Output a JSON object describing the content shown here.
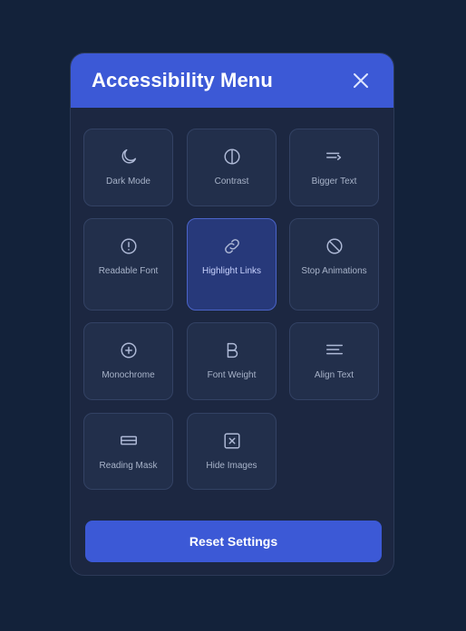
{
  "menu": {
    "title": "Accessibility Menu",
    "reset_label": "Reset Settings",
    "accent": "#3c59d6",
    "items": [
      {
        "label": "Dark Mode",
        "icon": "moon-icon",
        "active": true
      },
      {
        "label": "Contrast",
        "icon": "contrast-icon",
        "active": false
      },
      {
        "label": "Bigger Text",
        "icon": "text-size-icon",
        "active": false
      },
      {
        "label": "Readable Font",
        "icon": "alert-circle-icon",
        "active": false
      },
      {
        "label": "Highlight Links",
        "icon": "link-icon",
        "active": true
      },
      {
        "label": "Stop Animations",
        "icon": "stop-circle-icon",
        "active": false
      },
      {
        "label": "Monochrome",
        "icon": "plus-circle-icon",
        "active": false
      },
      {
        "label": "Font Weight",
        "icon": "bold-icon",
        "active": false
      },
      {
        "label": "Align Text",
        "icon": "align-left-icon",
        "active": false
      },
      {
        "label": "Reading Mask",
        "icon": "mask-icon",
        "active": false
      },
      {
        "label": "Hide Images",
        "icon": "hide-image-icon",
        "active": false
      }
    ]
  }
}
